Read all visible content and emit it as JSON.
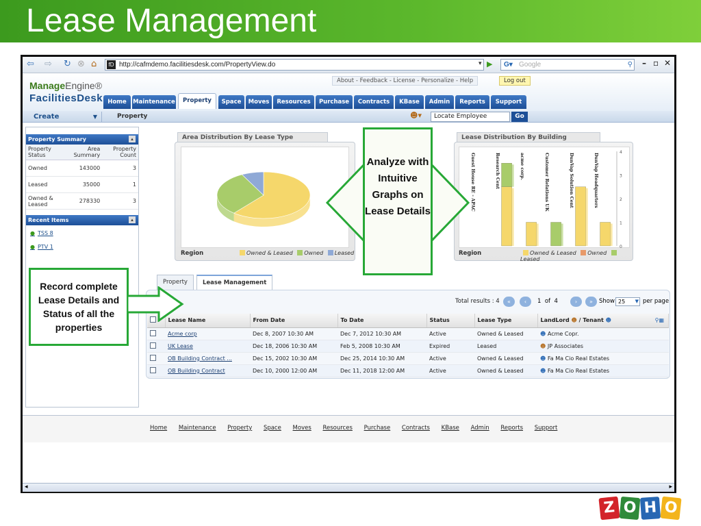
{
  "slide": {
    "title": "Lease Management"
  },
  "browser": {
    "url": "http://cafmdemo.facilitiesdesk.com/PropertyView.do",
    "search_placeholder": "Google"
  },
  "app": {
    "logo_line1_bold": "Manage",
    "logo_line1_rest": "Engine®",
    "logo_line2": "FacilitiesDesk",
    "top_links": "About - Feedback - License - Personalize - Help",
    "logout": "Log out",
    "tabs": [
      "Home",
      "Maintenance",
      "Property",
      "Space",
      "Moves",
      "Resources",
      "Purchase",
      "Contracts",
      "KBase",
      "Admin",
      "Reports",
      "Support"
    ],
    "active_tab": "Property",
    "create_label": "Create",
    "breadcrumb": "Property",
    "locate_placeholder": "Locate Employee",
    "go_label": "Go"
  },
  "property_summary": {
    "title": "Property Summary",
    "headers": [
      "Property Status",
      "Area Summary",
      "Property Count"
    ],
    "rows": [
      {
        "status": "Owned",
        "area": "143000",
        "count": "3"
      },
      {
        "status": "Leased",
        "area": "35000",
        "count": "1"
      },
      {
        "status": "Owned & Leased",
        "area": "278330",
        "count": "3"
      }
    ]
  },
  "recent_items": {
    "title": "Recent Items",
    "items": [
      "TSS 8",
      "PTV 1"
    ]
  },
  "chart_area": {
    "title": "Area Distribution By Lease Type",
    "xlabel": "Region",
    "legend": [
      "Owned & Leased",
      "Owned",
      "Leased"
    ]
  },
  "chart_building": {
    "title": "Lease Distribution By Building",
    "xlabel": "Region",
    "legend": [
      "Owned & Leased",
      "Owned",
      "Leased"
    ]
  },
  "chart_data": [
    {
      "type": "pie",
      "title": "Area Distribution By Lease Type",
      "xlabel": "Region",
      "categories": [
        "Owned & Leased",
        "Owned",
        "Leased"
      ],
      "values": [
        278330,
        143000,
        35000
      ],
      "colors": [
        "#f5d76b",
        "#a8cc6a",
        "#8fa9d6"
      ]
    },
    {
      "type": "bar",
      "title": "Lease Distribution By Building",
      "xlabel": "Region",
      "categories": [
        "Guest House RE - APAC",
        "Research Cent",
        "acme corp.",
        "Customer Relations UK",
        "DunVap Solution Cent",
        "DunVap Headquarters"
      ],
      "series": [
        {
          "name": "Owned & Leased",
          "values": [
            0,
            2.5,
            1,
            0,
            2.5,
            1
          ]
        },
        {
          "name": "Owned",
          "values": [
            0,
            0,
            0,
            0,
            0,
            0
          ]
        },
        {
          "name": "Leased",
          "values": [
            0,
            1,
            0,
            1,
            0,
            0
          ]
        }
      ],
      "ylim": [
        0,
        4
      ],
      "yticks": [
        "0",
        "1",
        "2",
        "3",
        "4"
      ]
    }
  ],
  "lower_tabs": [
    "Property",
    "Lease Management"
  ],
  "lease_list": {
    "total_results": "Total results : 4",
    "page_current": "1",
    "page_of": "of",
    "page_total": "4",
    "show_label": "Show",
    "show_value": "25",
    "per_page": "per page",
    "headers": [
      "Lease Name",
      "From Date",
      "To Date",
      "Status",
      "Lease Type",
      "LandLord",
      "/ Tenant"
    ],
    "rows": [
      {
        "name": "Acme corp",
        "from": "Dec 8, 2007 10:30 AM",
        "to": "Dec 7, 2012 10:30 AM",
        "status": "Active",
        "type": "Owned & Leased",
        "party": "Acme Copr."
      },
      {
        "name": "UK Lease",
        "from": "Dec 18, 2006 10:30 AM",
        "to": "Feb 5, 2008 10:30 AM",
        "status": "Expired",
        "type": "Leased",
        "party": "JP Associates"
      },
      {
        "name": "OB Building Contract ...",
        "from": "Dec 15, 2002 10:30 AM",
        "to": "Dec 25, 2014 10:30 AM",
        "status": "Active",
        "type": "Owned & Leased",
        "party": "Fa Ma Cio Real Estates"
      },
      {
        "name": "OB Building Contract",
        "from": "Dec 10, 2000 12:00 AM",
        "to": "Dec 11, 2018 12:00 AM",
        "status": "Active",
        "type": "Owned & Leased",
        "party": "Fa Ma Cio Real Estates"
      }
    ]
  },
  "footer_links": [
    "Home",
    "Maintenance",
    "Property",
    "Space",
    "Moves",
    "Resources",
    "Purchase",
    "Contracts",
    "KBase",
    "Admin",
    "Reports",
    "Support"
  ],
  "callouts": {
    "analyze": "Analyze with Intuitive Graphs on Lease Details",
    "record": "Record complete Lease Details and Status of all the properties"
  },
  "brand": {
    "letters": [
      "Z",
      "O",
      "H",
      "O"
    ],
    "colors": [
      "#d3232a",
      "#2f8a3a",
      "#2767b3",
      "#f3b41c"
    ]
  }
}
